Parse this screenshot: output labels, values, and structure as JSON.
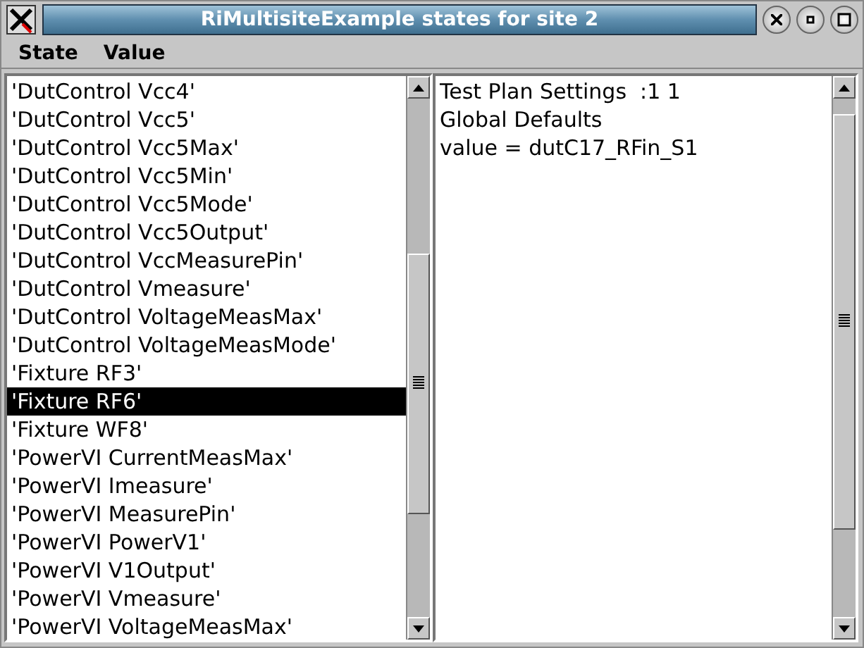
{
  "window": {
    "title": "RiMultisiteExample states for site 2"
  },
  "menu": [
    "State",
    "Value"
  ],
  "states": [
    {
      "label": "'DutControl Vcc4'",
      "selected": false
    },
    {
      "label": "'DutControl Vcc5'",
      "selected": false
    },
    {
      "label": "'DutControl Vcc5Max'",
      "selected": false
    },
    {
      "label": "'DutControl Vcc5Min'",
      "selected": false
    },
    {
      "label": "'DutControl Vcc5Mode'",
      "selected": false
    },
    {
      "label": "'DutControl Vcc5Output'",
      "selected": false
    },
    {
      "label": "'DutControl VccMeasurePin'",
      "selected": false
    },
    {
      "label": "'DutControl Vmeasure'",
      "selected": false
    },
    {
      "label": "'DutControl VoltageMeasMax'",
      "selected": false
    },
    {
      "label": "'DutControl VoltageMeasMode'",
      "selected": false
    },
    {
      "label": "'Fixture RF3'",
      "selected": false
    },
    {
      "label": "'Fixture RF6'",
      "selected": true
    },
    {
      "label": "'Fixture WF8'",
      "selected": false
    },
    {
      "label": "'PowerVI CurrentMeasMax'",
      "selected": false
    },
    {
      "label": "'PowerVI Imeasure'",
      "selected": false
    },
    {
      "label": "'PowerVI MeasurePin'",
      "selected": false
    },
    {
      "label": "'PowerVI PowerV1'",
      "selected": false
    },
    {
      "label": "'PowerVI V1Output'",
      "selected": false
    },
    {
      "label": "'PowerVI Vmeasure'",
      "selected": false
    },
    {
      "label": "'PowerVI VoltageMeasMax'",
      "selected": false
    }
  ],
  "value_text": [
    "Test Plan Settings  :1 1",
    "Global Defaults",
    "value = dutC17_RFin_S1"
  ]
}
